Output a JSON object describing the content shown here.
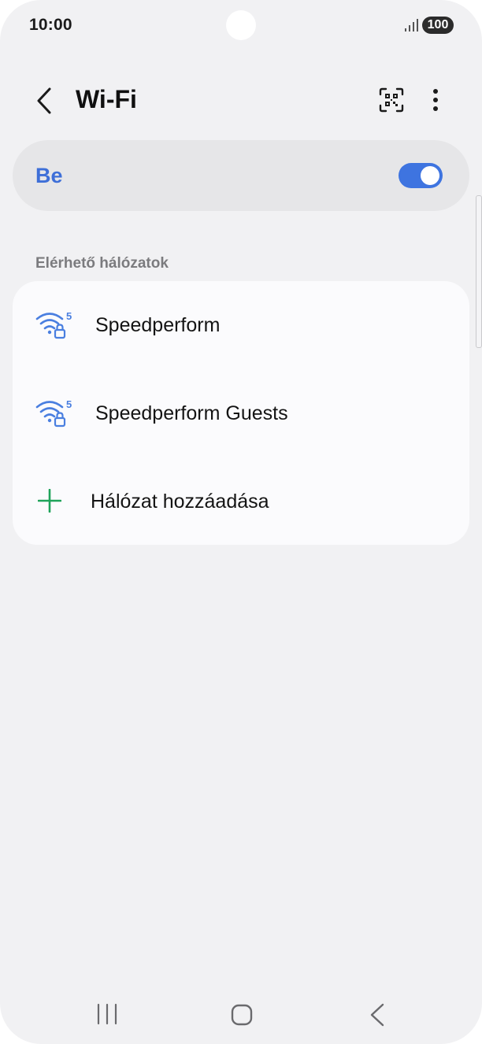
{
  "status_bar": {
    "time": "10:00",
    "battery": "100",
    "icons": [
      "signal-icon",
      "battery-icon"
    ]
  },
  "header": {
    "back_icon": "chevron-left-icon",
    "title": "Wi-Fi",
    "qr_icon": "qr-scan-icon",
    "more_icon": "more-vertical-icon"
  },
  "master_switch": {
    "label": "Be",
    "state": "on",
    "accent_color": "#3e74e0"
  },
  "networks_section": {
    "header": "Elérhető hálózatok",
    "networks": [
      {
        "name": "Speedperform",
        "icon": "wifi-5ghz-locked-icon"
      },
      {
        "name": "Speedperform Guests",
        "icon": "wifi-5ghz-locked-icon"
      }
    ],
    "wifi_band_label": "5",
    "add_network": {
      "label": "Hálózat hozzáadása",
      "icon": "plus-icon",
      "icon_color": "#1fa35a"
    }
  },
  "nav_bar": {
    "icons": [
      "recents-icon",
      "home-icon",
      "back-icon"
    ]
  }
}
